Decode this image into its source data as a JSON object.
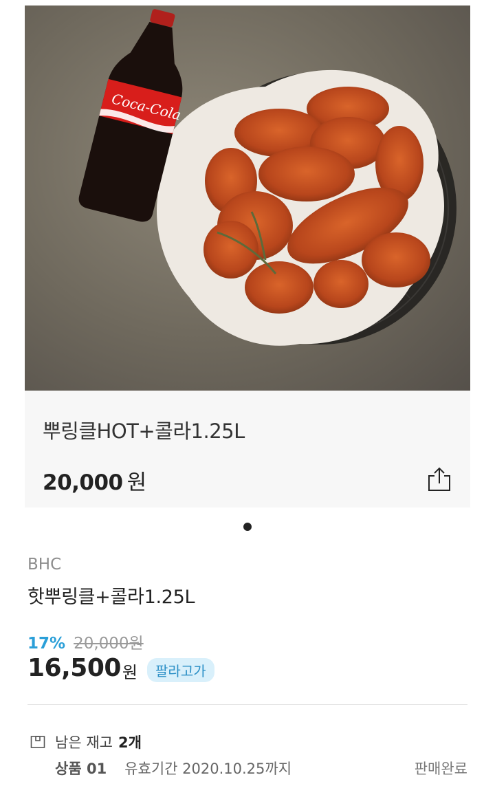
{
  "hero": {
    "image_alt": "Fried chicken in a basket with a cola bottle",
    "bottle_label": "Coca-Cola",
    "title": "뿌링클HOT+콜라1.25L",
    "price": "20,000",
    "price_unit": "원",
    "share_icon": "share-icon"
  },
  "pager": {
    "count": 1,
    "active": 1
  },
  "product": {
    "brand": "BHC",
    "name": "핫뿌링클+콜라1.25L",
    "discount_rate": "17%",
    "original_price": "20,000원",
    "sale_price": "16,500",
    "sale_unit": "원",
    "badge": "팔라고가"
  },
  "stock": {
    "icon": "box-icon",
    "label": "남은 재고",
    "count": "2개"
  },
  "items": [
    {
      "index": "상품 01",
      "expiry": "유효기간 2020.10.25까지",
      "status": "판매완료"
    }
  ],
  "colors": {
    "accent": "#2b9fd8",
    "badge_bg": "#d9f0fb"
  }
}
